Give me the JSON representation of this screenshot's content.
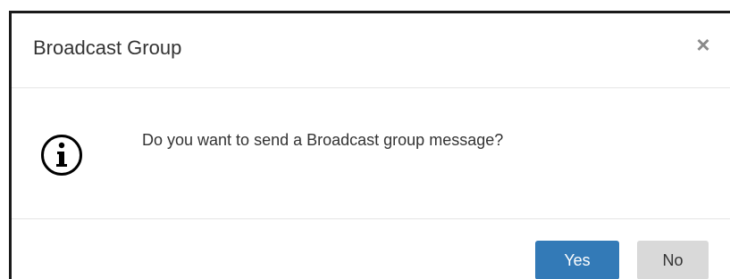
{
  "dialog": {
    "title": "Broadcast Group",
    "close_glyph": "×",
    "icon": "info-circle-icon",
    "message": "Do you want to send a Broadcast group message?",
    "buttons": {
      "yes_label": "Yes",
      "no_label": "No"
    }
  },
  "colors": {
    "primary_button": "#337ab7",
    "secondary_button": "#d9d9d9",
    "text": "#333333"
  }
}
